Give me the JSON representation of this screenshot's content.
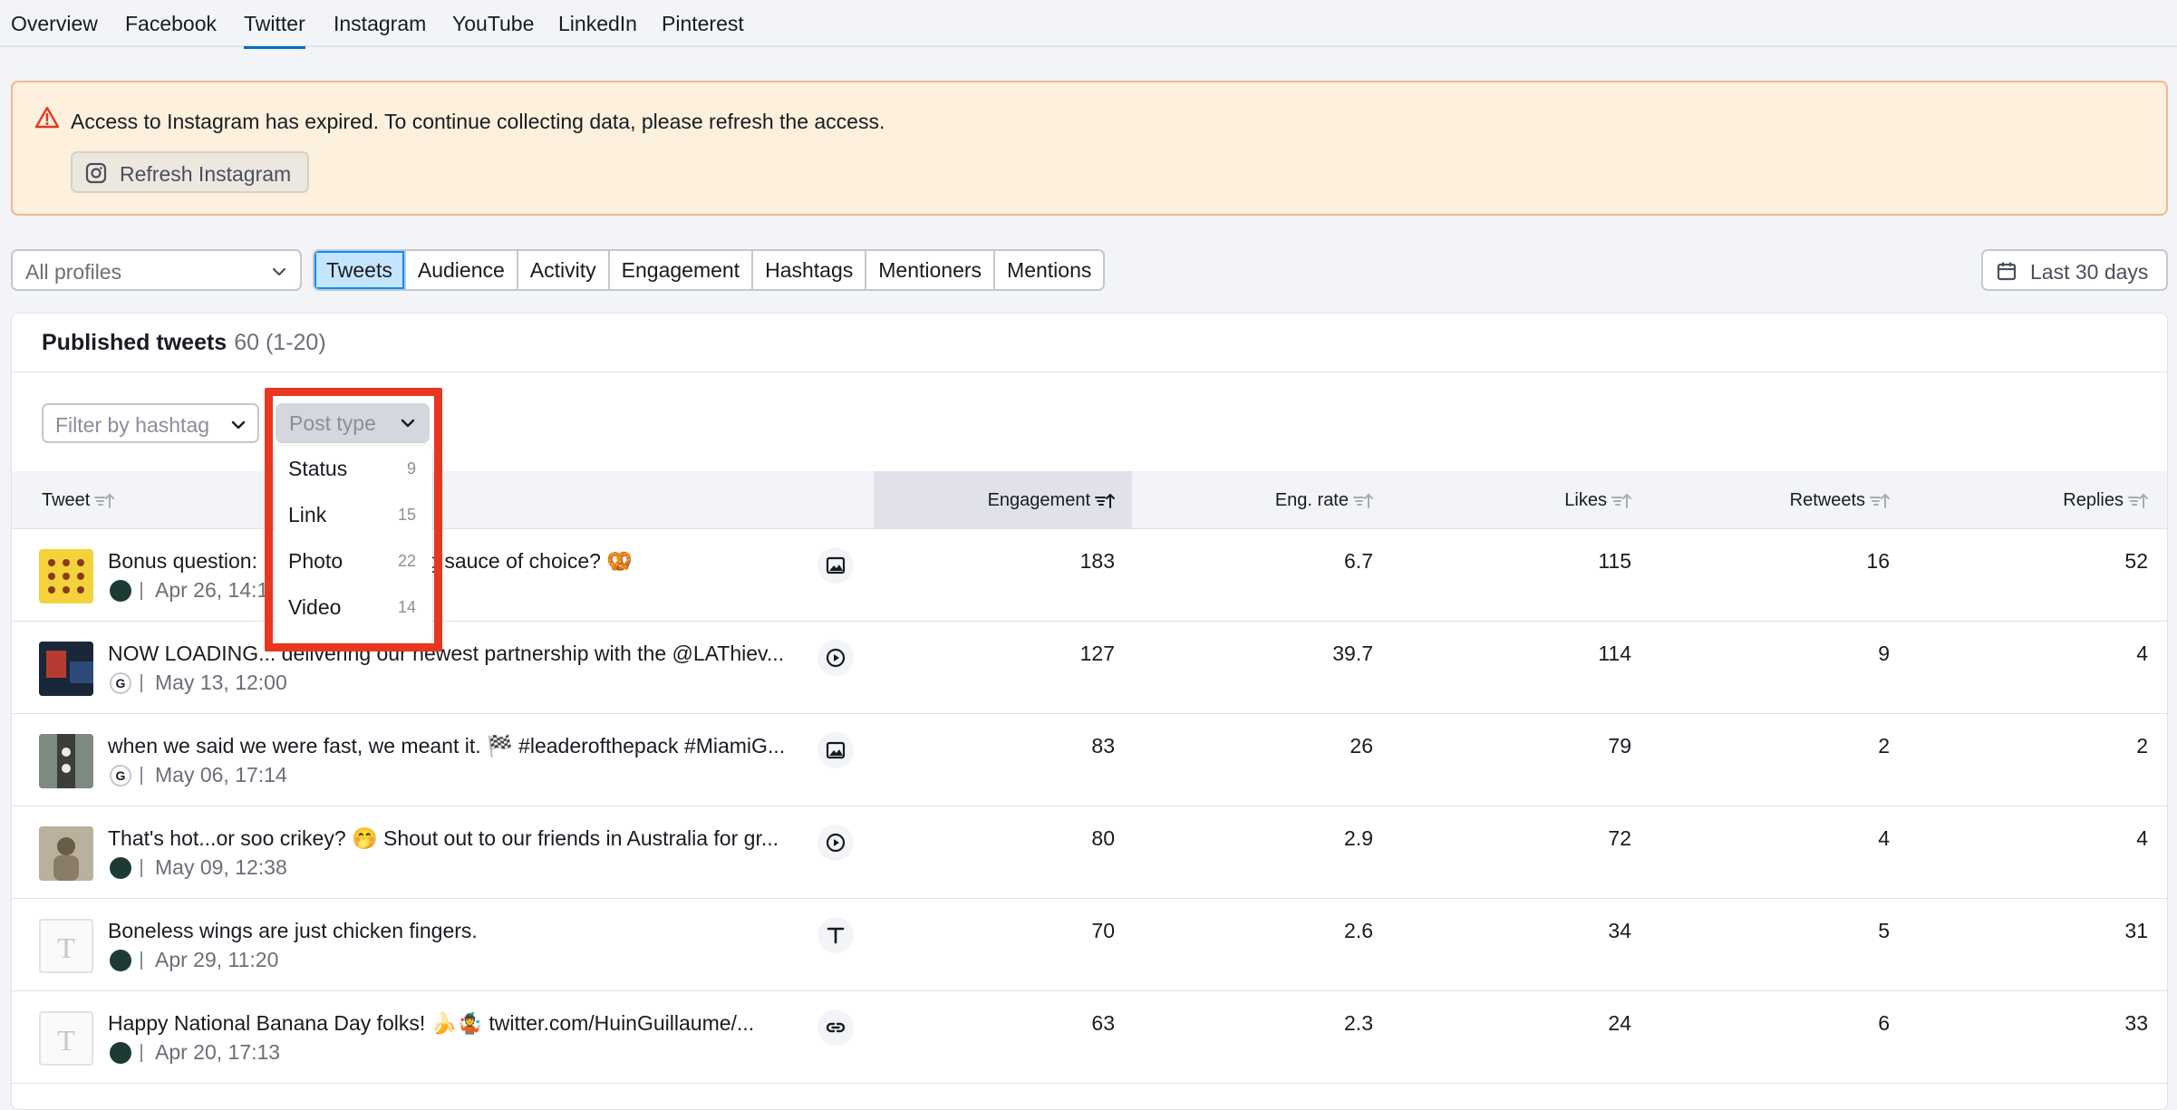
{
  "nav": {
    "tabs": [
      "Overview",
      "Facebook",
      "Twitter",
      "Instagram",
      "YouTube",
      "LinkedIn",
      "Pinterest"
    ],
    "active": "Twitter"
  },
  "alert": {
    "message": "Access to Instagram has expired. To continue collecting data, please refresh the access.",
    "button": "Refresh Instagram",
    "icon": "warning-triangle-icon"
  },
  "filters": {
    "profile_select": "All profiles",
    "segments": [
      "Tweets",
      "Audience",
      "Activity",
      "Engagement",
      "Hashtags",
      "Mentioners",
      "Mentions"
    ],
    "active_segment": "Tweets",
    "date_range": "Last 30 days"
  },
  "card": {
    "title": "Published tweets",
    "count": "60 (1-20)",
    "hashtag_placeholder": "Filter by hashtag",
    "post_type_label": "Post type"
  },
  "table": {
    "columns": {
      "tweet": "Tweet",
      "engagement": "Engagement",
      "eng_rate": "Eng. rate",
      "likes": "Likes",
      "retweets": "Retweets",
      "replies": "Replies"
    },
    "sorted_column": "Engagement",
    "rows": [
      {
        "text": "Bonus question: w… ng sauce of choice? 🥨",
        "text_visible_right": "ng sauce of choice? 🥨",
        "text_visible_left": "Bonus question: ",
        "date": "Apr 26, 14:1",
        "type": "photo",
        "engagement": "183",
        "eng_rate": "6.7",
        "likes": "115",
        "retweets": "16",
        "replies": "52",
        "avatar": "dark"
      },
      {
        "text": "NOW LOADING... delivering our newest partnership with the @LAThiev...",
        "date": "May 13, 12:00",
        "type": "video",
        "engagement": "127",
        "eng_rate": "39.7",
        "likes": "114",
        "retweets": "9",
        "replies": "4",
        "avatar": "g"
      },
      {
        "text": "when we said we were fast, we meant it. 🏁 #leaderofthepack #MiamiG...",
        "date": "May 06, 17:14",
        "type": "photo",
        "engagement": "83",
        "eng_rate": "26",
        "likes": "79",
        "retweets": "2",
        "replies": "2",
        "avatar": "g"
      },
      {
        "text": "That's hot...or soo crikey? 🤭 Shout out to our friends in Australia for gr...",
        "date": "May 09, 12:38",
        "type": "video",
        "engagement": "80",
        "eng_rate": "2.9",
        "likes": "72",
        "retweets": "4",
        "replies": "4",
        "avatar": "dark"
      },
      {
        "text": "Boneless wings are just chicken fingers.",
        "date": "Apr 29, 11:20",
        "type": "status",
        "engagement": "70",
        "eng_rate": "2.6",
        "likes": "34",
        "retweets": "5",
        "replies": "31",
        "avatar": "dark"
      },
      {
        "text": "Happy National Banana Day folks! 🍌🤹 twitter.com/HuinGuillaume/...",
        "date": "Apr 20, 17:13",
        "type": "link",
        "engagement": "63",
        "eng_rate": "2.3",
        "likes": "24",
        "retweets": "6",
        "replies": "33",
        "avatar": "dark"
      }
    ]
  },
  "post_type_dropdown": {
    "items": [
      {
        "label": "Status",
        "count": "9"
      },
      {
        "label": "Link",
        "count": "15"
      },
      {
        "label": "Photo",
        "count": "22"
      },
      {
        "label": "Video",
        "count": "14"
      }
    ]
  },
  "colors": {
    "accent": "#006dca",
    "active_segment_bg": "#c4e5fe",
    "alert_bg": "#fdf0dc",
    "highlight": "#e8371f"
  }
}
